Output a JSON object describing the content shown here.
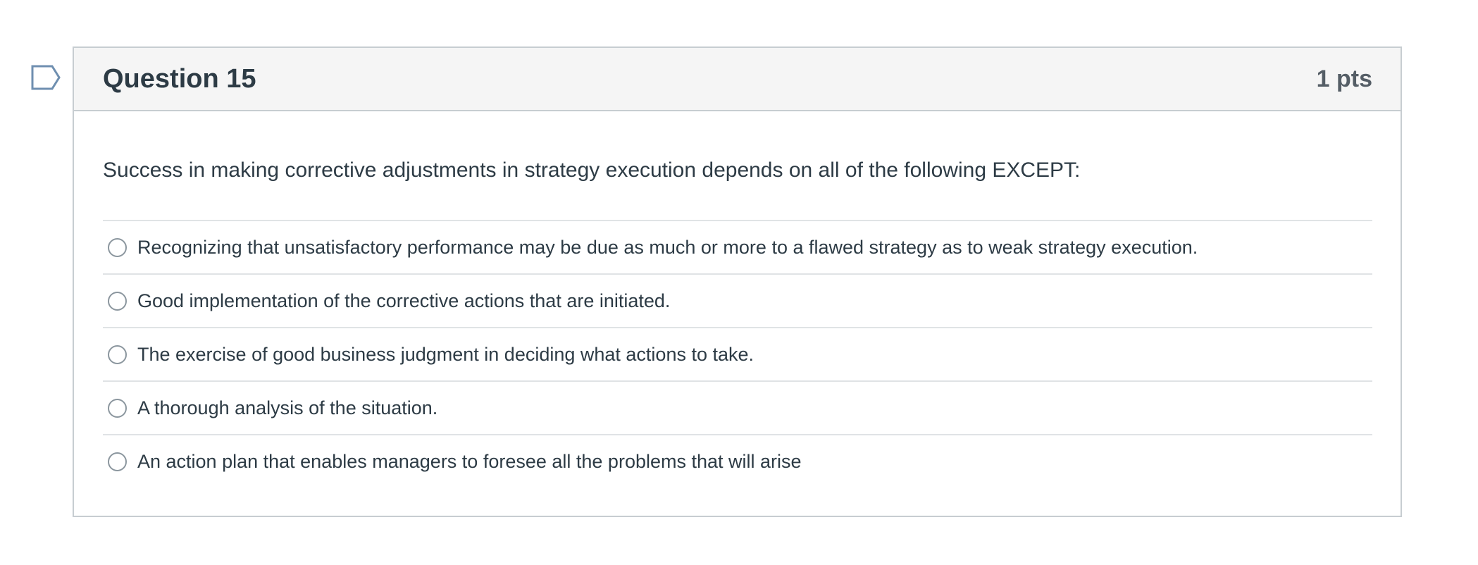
{
  "question": {
    "title": "Question 15",
    "points": "1 pts",
    "flag_icon": "bookmark-flag-icon",
    "text": "Success in making corrective adjustments in strategy execution depends on all of the following EXCEPT:",
    "answers": [
      {
        "label": "Recognizing that unsatisfactory performance may be due as much or more to a flawed strategy as to weak strategy execution."
      },
      {
        "label": "Good implementation of the corrective actions that are initiated."
      },
      {
        "label": "The exercise of good business judgment in deciding what actions to take."
      },
      {
        "label": "A thorough analysis of the situation."
      },
      {
        "label": "An action plan that enables managers to foresee all the problems that will arise"
      }
    ]
  },
  "colors": {
    "text": "#2d3b45",
    "header_bg": "#f5f5f5",
    "border": "#c7cdd1",
    "flag_outline": "#6f8fb0"
  }
}
